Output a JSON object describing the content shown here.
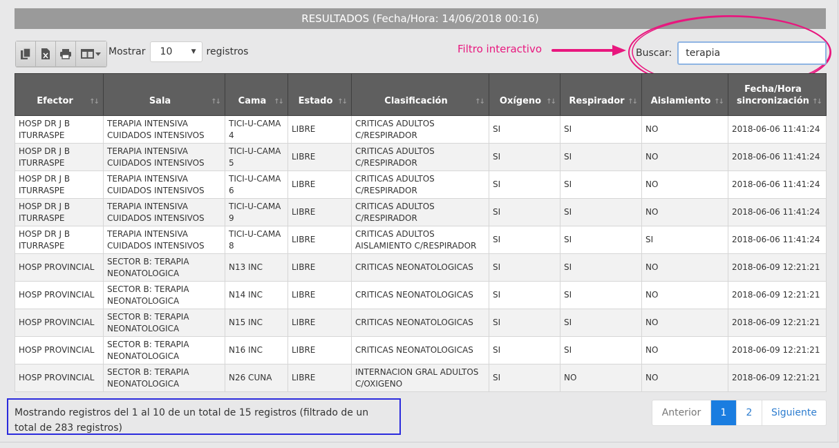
{
  "title": "RESULTADOS (Fecha/Hora: 14/06/2018 00:16)",
  "toolbar": {
    "buttons": [
      {
        "name": "copy-icon"
      },
      {
        "name": "excel-icon"
      },
      {
        "name": "print-icon"
      },
      {
        "name": "columns-icon"
      }
    ],
    "show_label": "Mostrar",
    "length_value": "10",
    "records_label": "registros"
  },
  "annotation": {
    "label": "Filtro interactivo",
    "color": "#e8177e"
  },
  "search": {
    "label": "Buscar:",
    "value": "terapia"
  },
  "table": {
    "headers": [
      "Efector",
      "Sala",
      "Cama",
      "Estado",
      "Clasificación",
      "Oxígeno",
      "Respirador",
      "Aislamiento",
      "Fecha/Hora sincronización"
    ],
    "rows": [
      [
        "HOSP DR J B ITURRASPE",
        "TERAPIA INTENSIVA CUIDADOS INTENSIVOS",
        "TICI-U-CAMA 4",
        "LIBRE",
        "CRITICAS ADULTOS C/RESPIRADOR",
        "SI",
        "SI",
        "NO",
        "2018-06-06 11:41:24"
      ],
      [
        "HOSP DR J B ITURRASPE",
        "TERAPIA INTENSIVA CUIDADOS INTENSIVOS",
        "TICI-U-CAMA 5",
        "LIBRE",
        "CRITICAS ADULTOS C/RESPIRADOR",
        "SI",
        "SI",
        "NO",
        "2018-06-06 11:41:24"
      ],
      [
        "HOSP DR J B ITURRASPE",
        "TERAPIA INTENSIVA CUIDADOS INTENSIVOS",
        "TICI-U-CAMA 6",
        "LIBRE",
        "CRITICAS ADULTOS C/RESPIRADOR",
        "SI",
        "SI",
        "NO",
        "2018-06-06 11:41:24"
      ],
      [
        "HOSP DR J B ITURRASPE",
        "TERAPIA INTENSIVA CUIDADOS INTENSIVOS",
        "TICI-U-CAMA 9",
        "LIBRE",
        "CRITICAS ADULTOS C/RESPIRADOR",
        "SI",
        "SI",
        "NO",
        "2018-06-06 11:41:24"
      ],
      [
        "HOSP DR J B ITURRASPE",
        "TERAPIA INTENSIVA CUIDADOS INTENSIVOS",
        "TICI-U-CAMA 8",
        "LIBRE",
        "CRITICAS ADULTOS AISLAMIENTO C/RESPIRADOR",
        "SI",
        "SI",
        "SI",
        "2018-06-06 11:41:24"
      ],
      [
        "HOSP PROVINCIAL",
        "SECTOR B: TERAPIA NEONATOLOGICA",
        "N13 INC",
        "LIBRE",
        "CRITICAS NEONATOLOGICAS",
        "SI",
        "SI",
        "NO",
        "2018-06-09 12:21:21"
      ],
      [
        "HOSP PROVINCIAL",
        "SECTOR B: TERAPIA NEONATOLOGICA",
        "N14 INC",
        "LIBRE",
        "CRITICAS NEONATOLOGICAS",
        "SI",
        "SI",
        "NO",
        "2018-06-09 12:21:21"
      ],
      [
        "HOSP PROVINCIAL",
        "SECTOR B: TERAPIA NEONATOLOGICA",
        "N15 INC",
        "LIBRE",
        "CRITICAS NEONATOLOGICAS",
        "SI",
        "SI",
        "NO",
        "2018-06-09 12:21:21"
      ],
      [
        "HOSP PROVINCIAL",
        "SECTOR B: TERAPIA NEONATOLOGICA",
        "N16 INC",
        "LIBRE",
        "CRITICAS NEONATOLOGICAS",
        "SI",
        "SI",
        "NO",
        "2018-06-09 12:21:21"
      ],
      [
        "HOSP PROVINCIAL",
        "SECTOR B: TERAPIA NEONATOLOGICA",
        "N26 CUNA",
        "LIBRE",
        "INTERNACION GRAL ADULTOS C/OXIGENO",
        "SI",
        "NO",
        "NO",
        "2018-06-09 12:21:21"
      ]
    ]
  },
  "info": "Mostrando registros del 1 al 10 de un total de 15 registros (filtrado de un total de 283 registros)",
  "pagination": {
    "previous": "Anterior",
    "pages": [
      "1",
      "2"
    ],
    "active_page": "1",
    "next": "Siguiente"
  },
  "colors": {
    "title_bar": "#9a9a9a",
    "header_bg": "#5f5f5f",
    "info_border": "#2a2add",
    "active_page": "#1a7de0"
  }
}
